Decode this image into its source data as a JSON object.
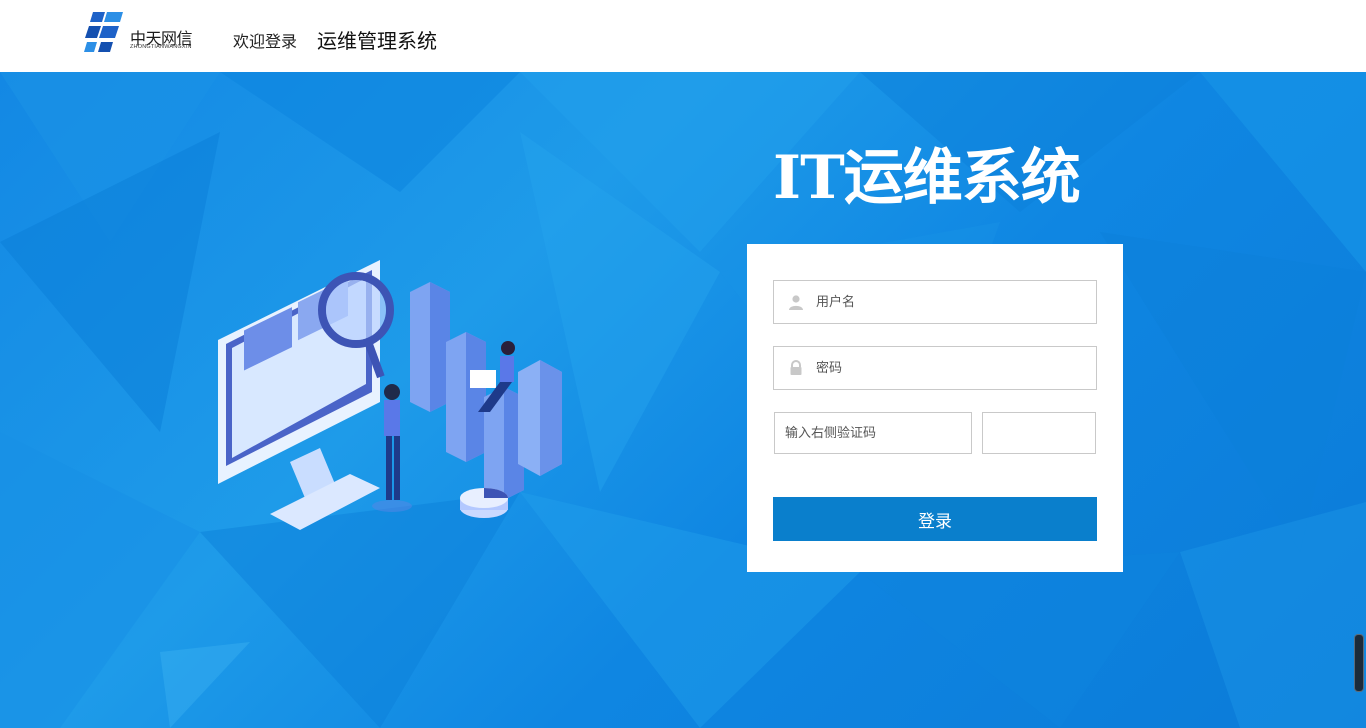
{
  "header": {
    "logo_cn": "中天网信",
    "logo_en": "ZHONGTIANWANGXIN",
    "welcome": "欢迎登录",
    "system_title": "运维管理系统"
  },
  "hero": {
    "title": "IT运维系统"
  },
  "login": {
    "username_placeholder": "用户名",
    "password_placeholder": "密码",
    "captcha_placeholder": "输入右侧验证码",
    "submit_label": "登录"
  },
  "icons": {
    "user": "user-icon",
    "lock": "lock-icon"
  },
  "colors": {
    "background": "#0a84e0",
    "button": "#0a7fcc",
    "header": "#ffffff"
  }
}
